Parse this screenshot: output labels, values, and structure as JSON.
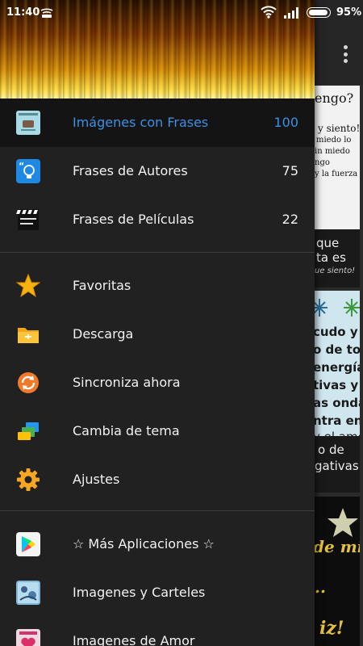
{
  "status_bar": {
    "time": "11:40",
    "battery": "95%"
  },
  "drawer": {
    "categories": [
      {
        "label": "Imágenes con Frases",
        "count": "100"
      },
      {
        "label": "Frases de Autores",
        "count": "75"
      },
      {
        "label": "Frases de Películas",
        "count": "22"
      }
    ],
    "actions": [
      {
        "label": "Favoritas",
        "icon": "star-icon"
      },
      {
        "label": "Descarga",
        "icon": "folder-icon"
      },
      {
        "label": "Sincroniza ahora",
        "icon": "sync-icon"
      },
      {
        "label": "Cambia de tema",
        "icon": "theme-icon"
      },
      {
        "label": "Ajustes",
        "icon": "gear-icon"
      }
    ],
    "more": [
      {
        "label": "☆ Más Aplicaciones ☆",
        "icon": "play-store-icon"
      },
      {
        "label": "Imagenes y Carteles",
        "icon": "app-icon-carteles"
      },
      {
        "label": "Imagenes de Amor",
        "icon": "app-icon-amor"
      }
    ]
  },
  "background_cards": {
    "card1": [
      "engo?",
      "y siento!",
      "miedo lo",
      "in miedo",
      "ngo",
      "y la fuerza",
      "que",
      "ta es",
      "ue siento!"
    ],
    "card2": [
      "cudo y",
      "o de toc",
      "energía",
      "tivas y",
      "as onda",
      "ntra en",
      "y el amo",
      "o de",
      "gativas"
    ],
    "card3": [
      "de mi",
      "..",
      "iz!"
    ]
  },
  "colors": {
    "active": "#3b91e6",
    "drawer_bg": "#212121",
    "active_row_bg": "#141414"
  }
}
